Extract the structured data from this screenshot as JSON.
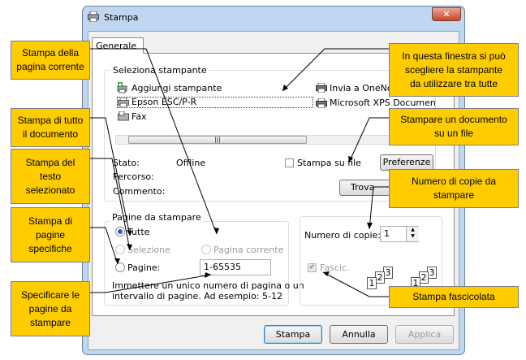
{
  "window": {
    "title": "Stampa",
    "close_symbol": "✕"
  },
  "tabs": [
    {
      "label": "Generale"
    }
  ],
  "printer_section": {
    "group_label": "Seleziona stampante",
    "printers": [
      {
        "label": "Aggiungi stampante",
        "icon": "add-printer-icon"
      },
      {
        "label": "Epson ESC/P-R",
        "icon": "printer-icon"
      },
      {
        "label": "Fax",
        "icon": "fax-icon"
      },
      {
        "label": "Invia a OneNo",
        "icon": "printer-icon"
      },
      {
        "label": "Microsoft XPS Documen",
        "icon": "printer-icon"
      }
    ],
    "scroll_thumb_grip": "|||",
    "status_label": "Stato:",
    "status_value": "Offline",
    "path_label": "Percorso:",
    "comment_label": "Commento:",
    "print_to_file_label": "Stampa su file",
    "print_to_file_checked": false,
    "preferences_button": "Preferenze",
    "find_button": "Trova stam"
  },
  "pages_section": {
    "group_label": "Pagine da stampare",
    "all_label": "Tutte",
    "selection_label": "Selezione",
    "current_page_label": "Pagina corrente",
    "pages_label": "Pagine:",
    "pages_value": "1-65535",
    "selected_option": "Tutte",
    "hint": [
      "Immettere un unico numero di pagina o un",
      "intervallo di pagine. Ad esempio: 5-12"
    ]
  },
  "copies_section": {
    "copies_label": "Numero di copie:",
    "copies_value": "1",
    "collate_label": "Fascic.",
    "collate_checked": true,
    "collate_pages": [
      "1",
      "2",
      "3"
    ]
  },
  "buttons": {
    "print": "Stampa",
    "cancel": "Annulla",
    "apply": "Applica"
  },
  "callouts": {
    "current_page": [
      "Stampa della",
      "pagina corrente"
    ],
    "all_document": [
      "Stampa di tutto",
      "il documento"
    ],
    "selected_text": [
      "Stampa del",
      "testo",
      "selezionato"
    ],
    "specific_pages": [
      "Stampa di",
      "pagine",
      "specifiche"
    ],
    "specify_pages": [
      "Specificare le",
      "pagine da",
      "stampare"
    ],
    "choose_printer": [
      "In questa finestra si può",
      "scegliere la stampante",
      "da utilizzare tra tutte"
    ],
    "print_to_file": [
      "Stampare un documento",
      "su un file"
    ],
    "copies": [
      "Numero di copie da",
      "stampare"
    ],
    "collated": [
      "Stampa fascicolata"
    ]
  },
  "colors": {
    "callout_fill": "#ffcc00",
    "frame": "#bfd7f0",
    "close_button": "#c8452c"
  }
}
